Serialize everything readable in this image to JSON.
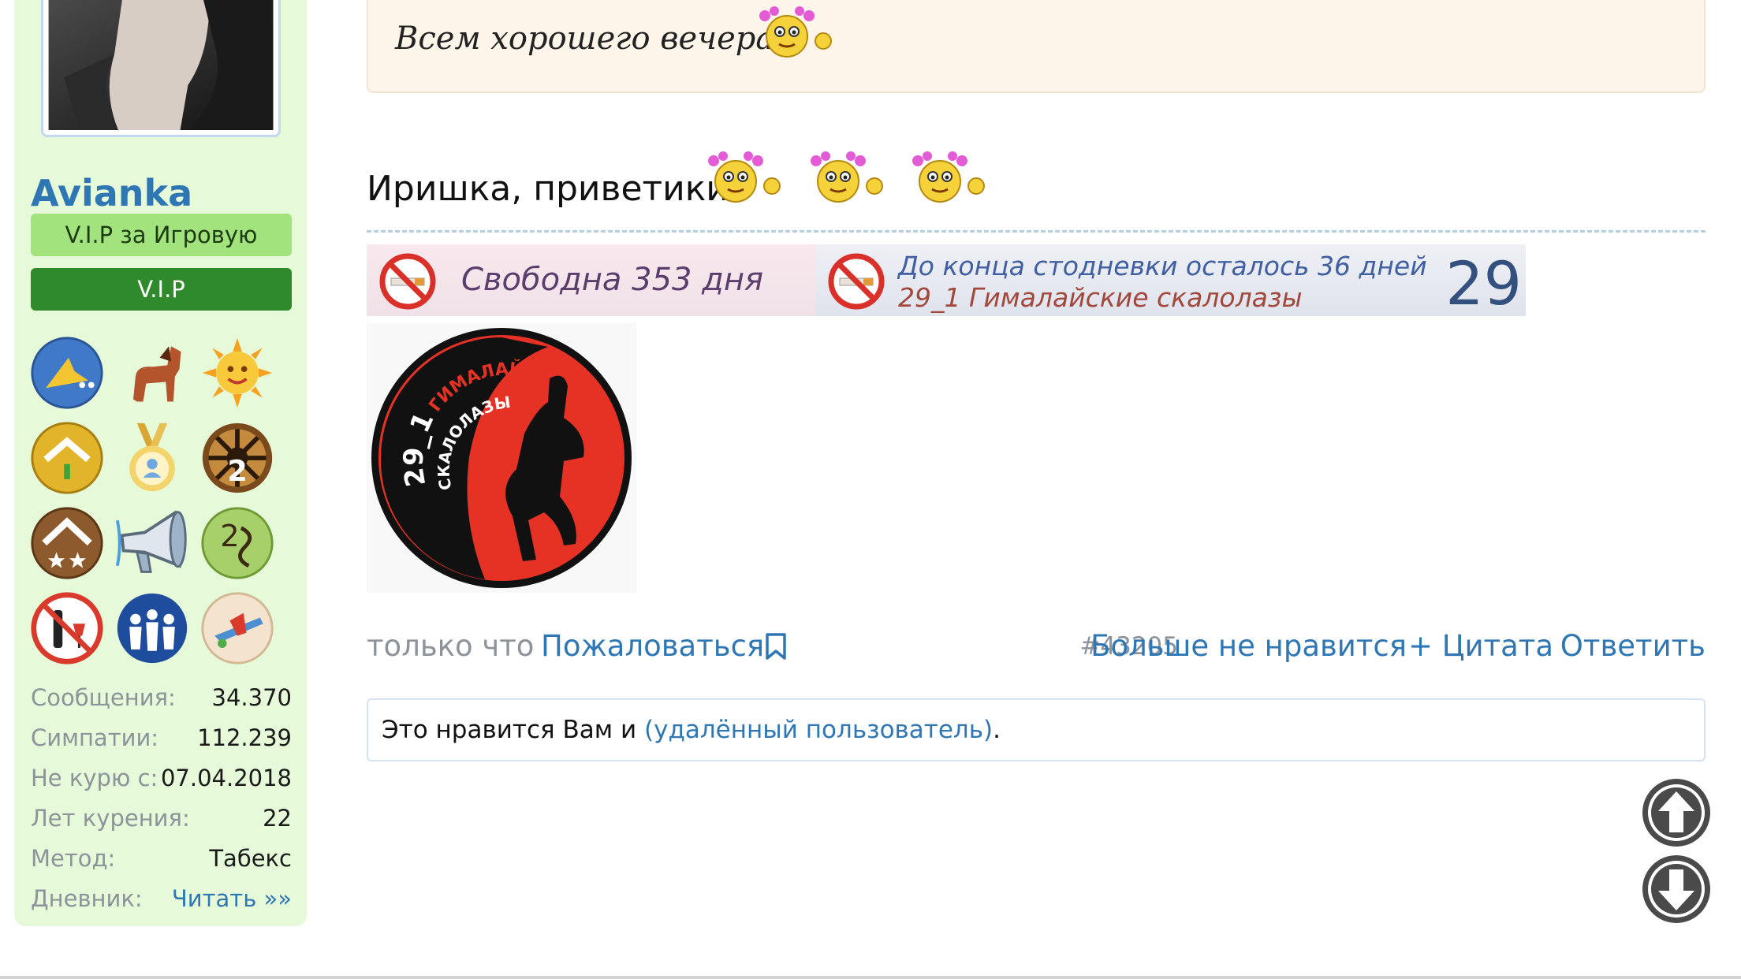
{
  "user": {
    "name": "Avianka",
    "title_primary": "V.I.P за Игровую",
    "title_secondary": "V.I.P",
    "stats": [
      {
        "label": "Сообщения:",
        "value": "34.370"
      },
      {
        "label": "Симпатии:",
        "value": "112.239"
      },
      {
        "label": "Не курю с:",
        "value": "07.04.2018"
      },
      {
        "label": "Лет курения:",
        "value": "22"
      },
      {
        "label": "Метод:",
        "value": "Табекс"
      }
    ],
    "diary_label": "Дневник:",
    "diary_link": "Читать »»",
    "awards": [
      "bird-award-icon",
      "horse-award-icon",
      "sun-award-icon",
      "gold-rank-award-icon",
      "medal-award-icon",
      "helm-award-icon",
      "stars-rank-award-icon",
      "megaphone-award-icon",
      "rank-2-award-icon",
      "no-alcohol-award-icon",
      "team-award-icon",
      "plane-award-icon"
    ]
  },
  "post": {
    "quote_text": "Всем хорошего вечера",
    "greeting": "Иришка, приветики",
    "banner1_text": "Свободна 353 дня",
    "banner2_line1": "До конца стодневки осталось 36 дней",
    "banner2_line2": "29_1 Гималайские скалолазы",
    "banner2_number": "29",
    "logo_number": "29_1",
    "logo_top_text": "ГИМАЛАЙСКИЕ",
    "logo_bottom_text": "СКАЛОЛАЗЫ"
  },
  "actions": {
    "time": "только что",
    "report": "Пожаловаться",
    "post_number": "#43205",
    "unlike": "Больше не нравится",
    "quote": "+ Цитата",
    "reply": "Ответить"
  },
  "likes": {
    "prefix": "Это нравится Вам и ",
    "user_link": "(удалённый пользователь)",
    "suffix": "."
  },
  "colors": {
    "link": "#2f77b4",
    "sidebar_bg": "#e6f9d8",
    "vip_light": "#a3e37e",
    "vip_dark": "#2e8a2b",
    "quote_bg": "#fdf5ea"
  }
}
